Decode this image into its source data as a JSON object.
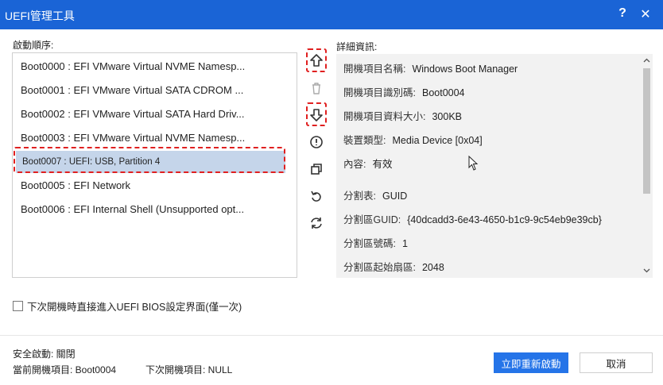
{
  "window": {
    "title": "UEFI管理工具",
    "help_label": "?",
    "close_label": "✕"
  },
  "boot_order": {
    "label": "啟動順序:",
    "items": [
      {
        "label": "Boot0000 : EFI VMware Virtual NVME Namesp..."
      },
      {
        "label": "Boot0001 : EFI VMware Virtual SATA CDROM ..."
      },
      {
        "label": "Boot0002 : EFI VMware Virtual SATA Hard Driv..."
      },
      {
        "label": "Boot0003 : EFI VMware Virtual NVME Namesp..."
      },
      {
        "label": "Boot0007 : UEFI:  USB, Partition 4",
        "selected": true
      },
      {
        "label": "Boot0005 : EFI Network"
      },
      {
        "label": "Boot0006 : EFI Internal Shell (Unsupported opt..."
      }
    ]
  },
  "toolbar": {
    "icons": [
      "move-up-icon",
      "delete-icon",
      "move-down-icon",
      "info-icon",
      "duplicate-icon",
      "undo-icon",
      "refresh-icon"
    ],
    "highlighted": [
      "move-up-icon",
      "move-down-icon"
    ]
  },
  "details": {
    "label": "詳細資訊:",
    "rows": [
      {
        "key": "開機項目名稱:",
        "value": "Windows Boot Manager"
      },
      {
        "key": "開機項目識別碼:",
        "value": "Boot0004"
      },
      {
        "key": "開機項目資料大小:",
        "value": "300KB"
      },
      {
        "key": "裝置類型:",
        "value": "Media Device [0x04]"
      },
      {
        "key": "內容:",
        "value": "有效"
      },
      {
        "key": "分割表:",
        "value": "GUID"
      },
      {
        "key": "分割區GUID:",
        "value": "{40dcadd3-6e43-4650-b1c9-9c54eb9e39cb}"
      },
      {
        "key": "分割區號碼:",
        "value": "1"
      },
      {
        "key": "分割區起始扇區:",
        "value": "2048"
      }
    ]
  },
  "next_boot_bios": {
    "label": "下次開機時直接進入UEFI BIOS設定界面(僅一次)",
    "checked": false
  },
  "status": {
    "secure_boot": "安全啟動:  關閉",
    "current_boot": "當前開機項目:  Boot0004",
    "next_boot": "下次開機項目:  NULL"
  },
  "buttons": {
    "restart": "立即重新啟動",
    "cancel": "取消"
  },
  "colors": {
    "titlebar": "#1a64d6",
    "primary_button": "#2574e8",
    "selection": "#c5d5ea",
    "highlight_outline": "#e02020"
  }
}
